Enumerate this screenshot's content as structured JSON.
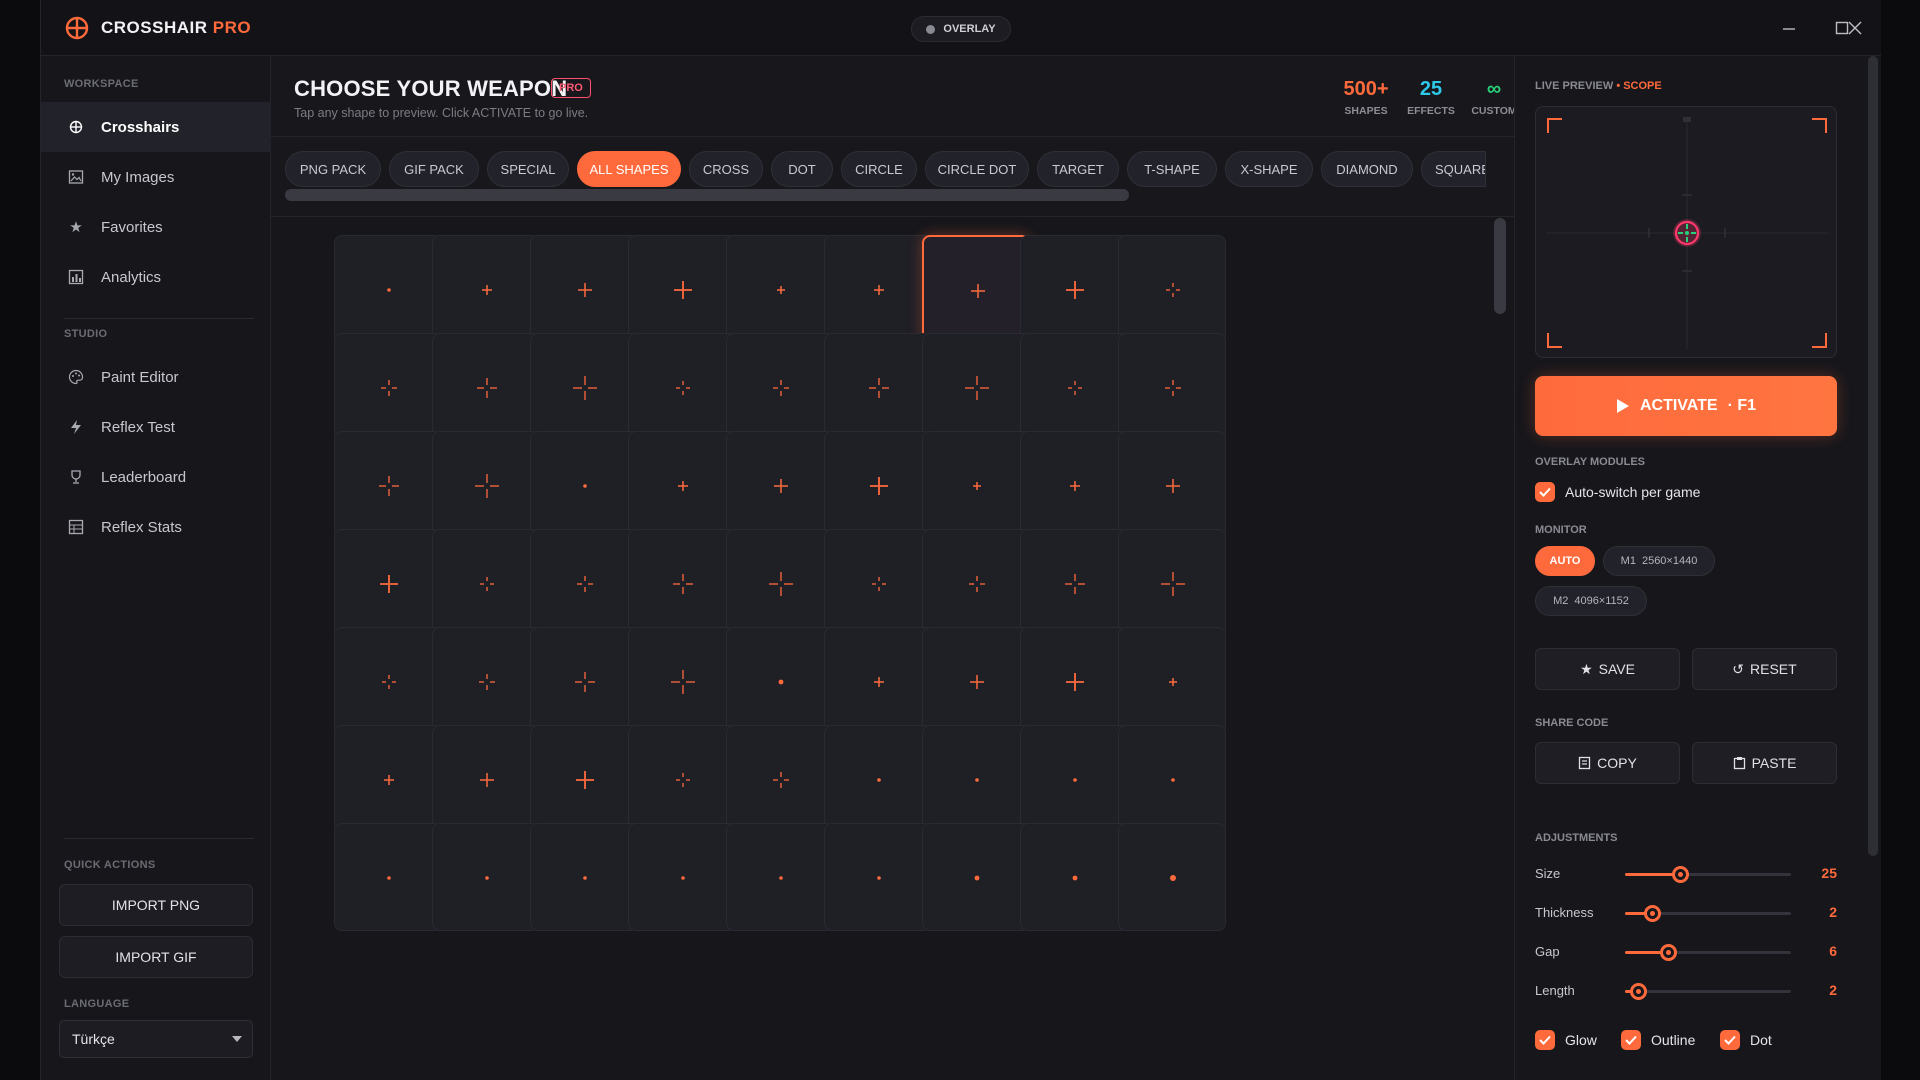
{
  "app": {
    "brand_main": "CROSSHAIR",
    "brand_accent": "PRO",
    "overlay_label": "OVERLAY",
    "accent_color": "#ff6a3d"
  },
  "sidebar": {
    "workspace_label": "WORKSPACE",
    "workspace_items": [
      {
        "label": "Crosshairs",
        "icon": "crosshair-icon",
        "active": true
      },
      {
        "label": "My Images",
        "icon": "images-icon"
      },
      {
        "label": "Favorites",
        "icon": "star-icon"
      },
      {
        "label": "Analytics",
        "icon": "bar-chart-icon"
      }
    ],
    "studio_label": "STUDIO",
    "studio_items": [
      {
        "label": "Paint Editor",
        "icon": "palette-icon"
      },
      {
        "label": "Reflex Test",
        "icon": "bolt-icon"
      },
      {
        "label": "Leaderboard",
        "icon": "trophy-icon"
      },
      {
        "label": "Reflex Stats",
        "icon": "stats-icon"
      }
    ],
    "quick_actions_label": "QUICK ACTIONS",
    "import_png": "IMPORT PNG",
    "import_gif": "IMPORT GIF",
    "language_label": "LANGUAGE",
    "language_value": "Türkçe"
  },
  "main": {
    "title": "CHOOSE YOUR WEAPON",
    "badge": "PRO",
    "subtitle": "Tap any shape to preview. Click ACTIVATE to go live.",
    "stats": [
      {
        "value": "500+",
        "label": "SHAPES",
        "color": "#ff6a3d"
      },
      {
        "value": "25",
        "label": "EFFECTS",
        "color": "#2ec8e8"
      },
      {
        "value": "∞",
        "label": "CUSTOM",
        "color": "#27d17a"
      }
    ],
    "tabs": [
      "PNG PACK",
      "GIF PACK",
      "SPECIAL",
      "ALL SHAPES",
      "CROSS",
      "DOT",
      "CIRCLE",
      "CIRCLE DOT",
      "TARGET",
      "T-SHAPE",
      "X-SHAPE",
      "DIAMOND",
      "SQUARE"
    ],
    "active_tab": "ALL SHAPES",
    "selected_cell": {
      "row": 1,
      "col": 7
    },
    "grid_rows": [
      [
        "dot-s",
        "plus-s",
        "plus-m",
        "plus-l",
        "plus-xs",
        "plus-s",
        "plus-m",
        "plus-l",
        "gap-xs"
      ],
      [
        "gap-s",
        "gap-m",
        "gap-l",
        "gap-xs",
        "gap-s",
        "gap-m",
        "gap-l",
        "gap-xs",
        "gap-s"
      ],
      [
        "gap-m",
        "gap-l",
        "dot-s",
        "plus-s",
        "plus-m",
        "plus-l",
        "plus-xs",
        "plus-s",
        "plus-m"
      ],
      [
        "plus-l",
        "gap-xs",
        "gap-s",
        "gap-m",
        "gap-l",
        "gap-xs",
        "gap-s",
        "gap-m",
        "gap-l"
      ],
      [
        "gap-xs",
        "gap-s",
        "gap-m",
        "gap-l",
        "dot-m",
        "plus-s",
        "plus-m",
        "plus-l",
        "plus-xs"
      ],
      [
        "plus-s",
        "plus-m",
        "plus-l",
        "gap-xs",
        "gap-s",
        "dot-s",
        "dot-s",
        "dot-s",
        "dot-s"
      ],
      [
        "dot-s",
        "dot-s",
        "dot-s",
        "dot-s",
        "dot-s",
        "dot-s",
        "dot-m",
        "dot-m",
        "dot-l"
      ]
    ]
  },
  "right_panel": {
    "preview_label": "LIVE PREVIEW",
    "preview_mode": "• SCOPE",
    "activate_label": "ACTIVATE",
    "activate_hotkey": "· F1",
    "overlay_modules_label": "OVERLAY MODULES",
    "auto_switch_label": "Auto-switch per game",
    "monitor_label": "MONITOR",
    "monitors": [
      {
        "id": "AUTO",
        "res": "",
        "active": true
      },
      {
        "id": "M1",
        "res": "2560×1440"
      },
      {
        "id": "M2",
        "res": "4096×1152"
      }
    ],
    "save_label": "SAVE",
    "reset_label": "RESET",
    "share_code_label": "SHARE CODE",
    "copy_label": "COPY",
    "paste_label": "PASTE",
    "adjustments_label": "ADJUSTMENTS",
    "adjustments": [
      {
        "label": "Size",
        "value": "25",
        "fraction": 0.33
      },
      {
        "label": "Thickness",
        "value": "2",
        "fraction": 0.16
      },
      {
        "label": "Gap",
        "value": "6",
        "fraction": 0.26
      },
      {
        "label": "Length",
        "value": "2",
        "fraction": 0.08
      }
    ],
    "toggles": [
      {
        "label": "Glow",
        "checked": true
      },
      {
        "label": "Outline",
        "checked": true
      },
      {
        "label": "Dot",
        "checked": true
      }
    ]
  }
}
